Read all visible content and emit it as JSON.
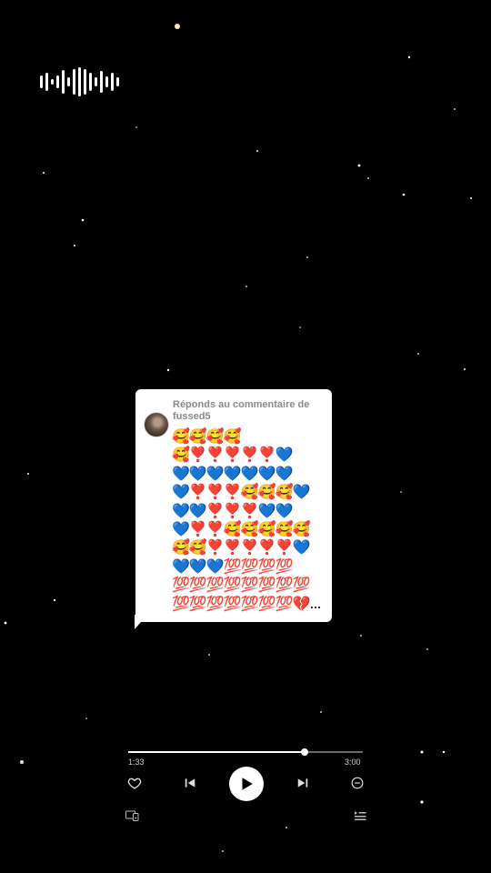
{
  "comment": {
    "reply_label": "Réponds au commentaire de fussed5",
    "emoji_lines": [
      "🥰🥰🥰🥰",
      "🥰❣️❣️❣️❣️❣️💙",
      "💙💙💙💙💙💙💙",
      "💙❣️❣️❣️🥰🥰🥰💙",
      "💙💙❣️❣️❣️💙💙",
      "💙❣️❣️🥰🥰🥰🥰🥰",
      "🥰🥰❣️❣️❣️❣️❣️💙",
      "💙💙💙💯💯💯💯",
      "💯💯💯💯💯💯💯💯",
      "💯💯💯💯💯💯💯💔..."
    ]
  },
  "player": {
    "elapsed": "1:33",
    "total": "3:00",
    "progress": 0.752
  },
  "icons": {
    "waveform": "sound-wave-icon",
    "like": "heart-outline-icon",
    "prev": "skip-previous-icon",
    "play": "play-icon",
    "next": "skip-next-icon",
    "minus": "remove-circle-icon",
    "cast": "connect-device-icon",
    "queue": "queue-list-icon"
  }
}
